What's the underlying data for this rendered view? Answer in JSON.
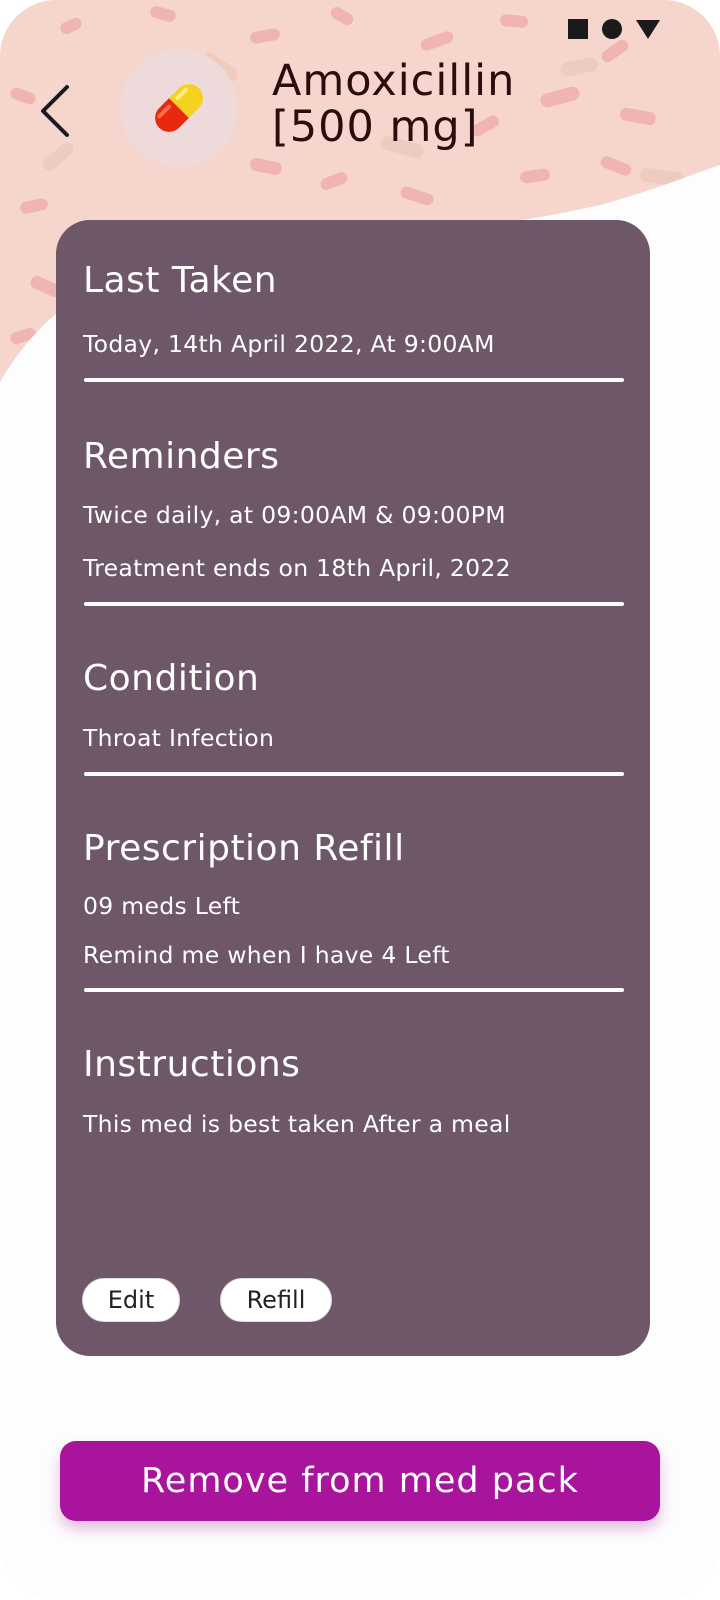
{
  "header": {
    "title_line1": "Amoxicillin",
    "title_line2": "[500 mg]",
    "back_icon": "chevron-left-icon",
    "med_icon": "capsule-icon",
    "bg_color": "#f6d6cc",
    "capsule_colors": [
      "#f5d21e",
      "#e8280f"
    ]
  },
  "status_bar": {
    "icons": [
      "square-icon",
      "circle-icon",
      "triangle-down-icon"
    ]
  },
  "card": {
    "bg_color": "#6d5769",
    "last_taken": {
      "title": "Last Taken",
      "value": "Today, 14th April 2022, At 9:00AM"
    },
    "reminders": {
      "title": "Reminders",
      "line1": "Twice daily, at 09:00AM & 09:00PM",
      "line2": "Treatment ends on 18th April, 2022"
    },
    "condition": {
      "title": "Condition",
      "value": "Throat Infection"
    },
    "prescription_refill": {
      "title": "Prescription Refill",
      "line1": "09 meds Left",
      "line2": "Remind me when I have 4 Left"
    },
    "instructions": {
      "title": "Instructions",
      "value": "This med is best taken After a meal"
    },
    "edit_label": "Edit",
    "refill_label": "Refill"
  },
  "footer": {
    "remove_label": "Remove from med pack",
    "accent_color": "#a8149b"
  }
}
